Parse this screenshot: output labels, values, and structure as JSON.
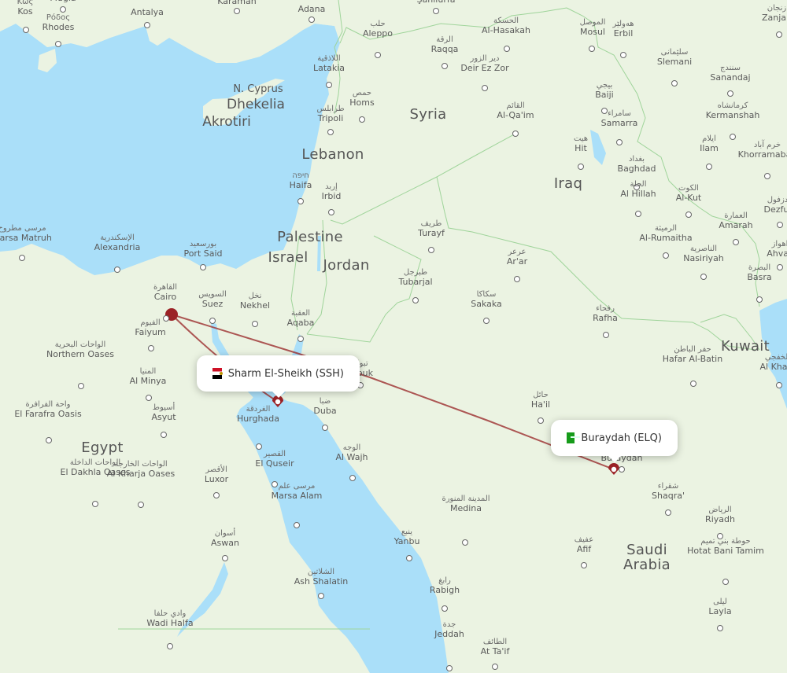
{
  "colors": {
    "land": "#ebf3e2",
    "water": "#aadff9",
    "border": "#9fd49a",
    "route": "#a13a3a",
    "marker": "#9b2226"
  },
  "route": {
    "origin_hub": {
      "name": "Cairo"
    },
    "from": {
      "city": "Sharm El-Sheikh",
      "code": "SSH",
      "label": "Sharm El-Sheikh (SSH)",
      "flag": "egypt-flag-icon"
    },
    "to": {
      "city": "Buraydah",
      "code": "ELQ",
      "label": "Buraydah (ELQ)",
      "flag": "saudi-arabia-flag-icon"
    }
  },
  "countries": [
    {
      "name": "Egypt"
    },
    {
      "name": "Syria"
    },
    {
      "name": "Iraq"
    },
    {
      "name": "Jordan"
    },
    {
      "name": "Israel"
    },
    {
      "name": "Palestine"
    },
    {
      "name": "Lebanon"
    },
    {
      "name": "Kuwait"
    },
    {
      "name": "Saudi Arabia",
      "lines": [
        "Saudi",
        "Arabia"
      ]
    },
    {
      "name": "Dhekelia"
    },
    {
      "name": "Akrotiri"
    },
    {
      "name": "N. Cyprus"
    }
  ],
  "cities": [
    {
      "en": "Kos",
      "ar": "Κως"
    },
    {
      "en": "Muğla",
      "ar": ""
    },
    {
      "en": "Rhodes",
      "ar": "Ρόδος"
    },
    {
      "en": "Antalya",
      "ar": ""
    },
    {
      "en": "Karaman",
      "ar": ""
    },
    {
      "en": "Adana",
      "ar": ""
    },
    {
      "en": "Şanlıurfa",
      "ar": ""
    },
    {
      "en": "Aleppo",
      "ar": "حلب"
    },
    {
      "en": "Al-Hasakah",
      "ar": "الحسكة"
    },
    {
      "en": "Mosul",
      "ar": "الموصل"
    },
    {
      "en": "Erbil",
      "ar": "هەولێر"
    },
    {
      "en": "Zanjan",
      "ar": "زنجان"
    },
    {
      "en": "Raqqa",
      "ar": "الرقة"
    },
    {
      "en": "Deir Ez Zor",
      "ar": "دير الزور"
    },
    {
      "en": "Latakia",
      "ar": "اللاذقية"
    },
    {
      "en": "Homs",
      "ar": "حمص"
    },
    {
      "en": "Tripoli",
      "ar": "طرابلس"
    },
    {
      "en": "Slemani",
      "ar": "سلێمانی"
    },
    {
      "en": "Sanandaj",
      "ar": "سنندج"
    },
    {
      "en": "Baiji",
      "ar": "بيجي"
    },
    {
      "en": "Kermanshah",
      "ar": "كرمانشاه"
    },
    {
      "en": "Al-Qa'im",
      "ar": "القائم"
    },
    {
      "en": "Samarra",
      "ar": "سامراء"
    },
    {
      "en": "Hit",
      "ar": "هيت"
    },
    {
      "en": "Baghdad",
      "ar": "بغداد"
    },
    {
      "en": "Ilam",
      "ar": "ايلام"
    },
    {
      "en": "Khorramabad",
      "ar": "خرم آباد"
    },
    {
      "en": "Haifa",
      "ar": "חיפה"
    },
    {
      "en": "Irbid",
      "ar": "إربد"
    },
    {
      "en": "Al Hillah",
      "ar": "الحلة"
    },
    {
      "en": "Al-Kut",
      "ar": "الكوت"
    },
    {
      "en": "Dezful",
      "ar": "دزفول"
    },
    {
      "en": "Amarah",
      "ar": "العمارة"
    },
    {
      "en": "Ahvaz",
      "ar": "اهواز"
    },
    {
      "en": "Marsa Matruh",
      "ar": "مرسى مطروح"
    },
    {
      "en": "Alexandria",
      "ar": "الإسكندرية"
    },
    {
      "en": "Port Said",
      "ar": "بورسعيد"
    },
    {
      "en": "Turayf",
      "ar": "طريف"
    },
    {
      "en": "Al-Rumaitha",
      "ar": "الرميثة"
    },
    {
      "en": "Nasiriyah",
      "ar": "الناصرية"
    },
    {
      "en": "Ar'ar",
      "ar": "عرعر"
    },
    {
      "en": "Tubarjal",
      "ar": "طبرجل"
    },
    {
      "en": "Basra",
      "ar": "البصرة"
    },
    {
      "en": "Cairo",
      "ar": "القاهرة"
    },
    {
      "en": "Suez",
      "ar": "السويس"
    },
    {
      "en": "Nekhel",
      "ar": "نخل"
    },
    {
      "en": "Sakaka",
      "ar": "سكاكا"
    },
    {
      "en": "Faiyum",
      "ar": "الفيوم"
    },
    {
      "en": "Aqaba",
      "ar": "العقبة"
    },
    {
      "en": "Rafha",
      "ar": "رفحاء"
    },
    {
      "en": "Tabuk",
      "ar": "تبوك"
    },
    {
      "en": "Hafar Al-Batin",
      "ar": "حفر الباطن"
    },
    {
      "en": "Al Khafji",
      "ar": "الخفجي"
    },
    {
      "en": "Northern Oases",
      "ar": "الواحات البحرية"
    },
    {
      "en": "Al Minya",
      "ar": "المنيا"
    },
    {
      "en": "Ha'il",
      "ar": "حائل"
    },
    {
      "en": "El Farafra Oasis",
      "ar": "واحة الفرافرة"
    },
    {
      "en": "Asyut",
      "ar": "أسيوط"
    },
    {
      "en": "Hurghada",
      "ar": "الغردقة"
    },
    {
      "en": "Duba",
      "ar": "ضبا"
    },
    {
      "en": "Buraydah",
      "ar": "بريدة"
    },
    {
      "en": "Al Wajh",
      "ar": "الوجه"
    },
    {
      "en": "El Quseir",
      "ar": "القصير"
    },
    {
      "en": "El Dakhla Oases",
      "ar": "الواحات الداخلة"
    },
    {
      "en": "Al Kharja Oases",
      "ar": "الواحات الخارجة"
    },
    {
      "en": "Luxor",
      "ar": "الأقصر"
    },
    {
      "en": "Marsa Alam",
      "ar": "مرسى علم"
    },
    {
      "en": "Shaqra'",
      "ar": "شقراء"
    },
    {
      "en": "Medina",
      "ar": "المدينة المنورة"
    },
    {
      "en": "Riyadh",
      "ar": "الرياض"
    },
    {
      "en": "Aswan",
      "ar": "أسوان"
    },
    {
      "en": "Yanbu",
      "ar": "ينبع"
    },
    {
      "en": "Afif",
      "ar": "عفيف"
    },
    {
      "en": "Hotat Bani Tamim",
      "ar": "حوطة بني تميم"
    },
    {
      "en": "Ash Shalatin",
      "ar": "الشلاتين"
    },
    {
      "en": "Rabigh",
      "ar": "رابغ"
    },
    {
      "en": "Layla",
      "ar": "ليلى"
    },
    {
      "en": "Wadi Halfa",
      "ar": "وادي حلفا"
    },
    {
      "en": "Jeddah",
      "ar": "جدة"
    },
    {
      "en": "At Ta'if",
      "ar": "الطائف"
    }
  ]
}
